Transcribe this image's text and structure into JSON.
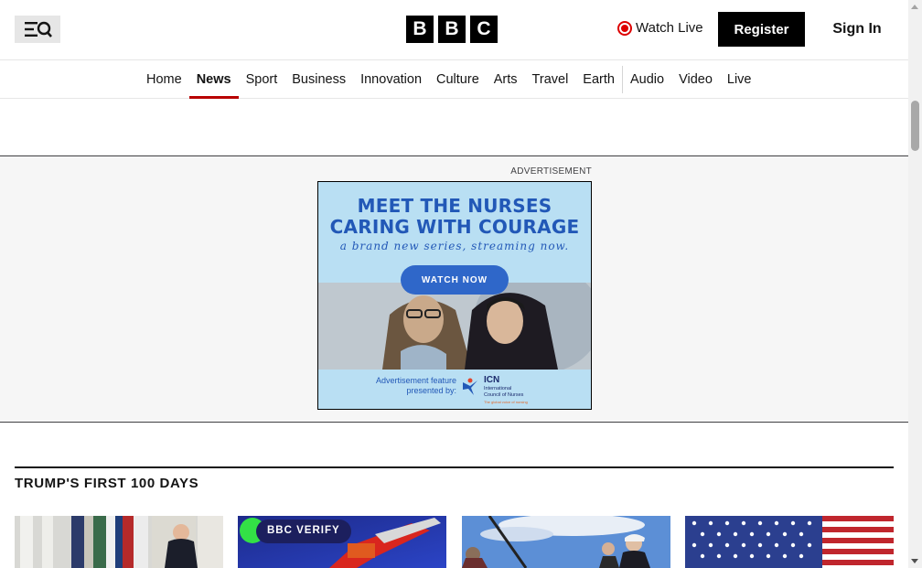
{
  "header": {
    "menu_icon": "menu-search-icon",
    "logo_letters": [
      "B",
      "B",
      "C"
    ],
    "watch_live_label": "Watch Live",
    "register_label": "Register",
    "signin_label": "Sign In"
  },
  "nav": {
    "items": [
      "Home",
      "News",
      "Sport",
      "Business",
      "Innovation",
      "Culture",
      "Arts",
      "Travel",
      "Earth",
      "Audio",
      "Video",
      "Live"
    ],
    "active": "News",
    "active_color": "#b80000"
  },
  "ad": {
    "label": "ADVERTISEMENT",
    "headline_1": "MEET THE NURSES",
    "headline_2": "CARING WITH COURAGE",
    "subline": "a brand new series, streaming now.",
    "cta": "WATCH NOW",
    "presented_by": "Advertisement feature presented by:",
    "sponsor": "ICN",
    "sponsor_full": "International Council of Nurses",
    "sponsor_tagline": "The global voice of nursing",
    "accent": "#2258b7"
  },
  "section": {
    "title": "TRUMP'S FIRST 100 DAYS",
    "verify_badge": "BBC VERIFY"
  }
}
